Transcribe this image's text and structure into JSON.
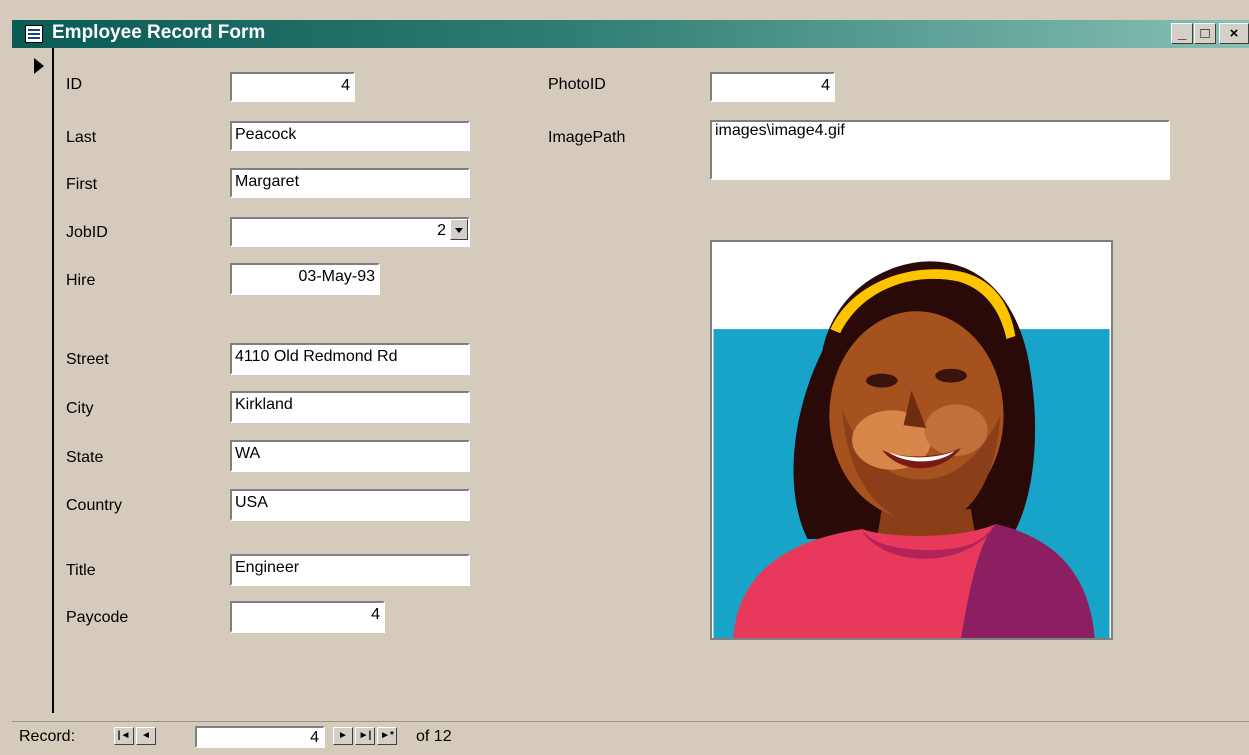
{
  "window": {
    "title": "Employee Record Form",
    "minimize": "_",
    "maximize": "□",
    "close": "×"
  },
  "form": {
    "labels": {
      "id": "ID",
      "last": "Last",
      "first": "First",
      "jobid": "JobID",
      "hire": "Hire",
      "street": "Street",
      "city": "City",
      "state": "State",
      "country": "Country",
      "title": "Title",
      "paycode": "Paycode",
      "photoid": "PhotoID",
      "imagepath": "ImagePath"
    },
    "values": {
      "id": "4",
      "last": "Peacock",
      "first": "Margaret",
      "jobid": "2",
      "hire": "03-May-93",
      "street": "4110 Old Redmond Rd",
      "city": "Kirkland",
      "state": "WA",
      "country": "USA",
      "title": "Engineer",
      "paycode": "4",
      "photoid": "4",
      "imagepath": "images\\image4.gif"
    }
  },
  "navigation": {
    "label": "Record:",
    "current": "4",
    "of_text": "of 12"
  },
  "colors": {
    "form_bg": "#d4cbbd",
    "titlebar": "#0a5a55",
    "photo_blue": "#18a4c8",
    "shirt": "#e8395c"
  }
}
